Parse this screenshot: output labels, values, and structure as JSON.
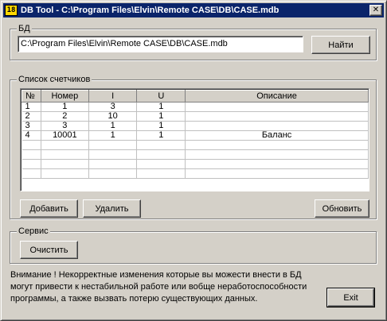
{
  "window": {
    "title": "DB Tool - C:\\Program Files\\Elvin\\Remote CASE\\DB\\CASE.mdb",
    "icon_glyph": "18",
    "close_glyph": "✕"
  },
  "db_group": {
    "label": "БД",
    "path_value": "C:\\Program Files\\Elvin\\Remote CASE\\DB\\CASE.mdb",
    "find_button": "Найти"
  },
  "counters_group": {
    "label": "Список счетчиков",
    "columns": [
      "№",
      "Номер",
      "I",
      "U",
      "Описание"
    ],
    "rows": [
      {
        "n": "1",
        "number": "1",
        "i": "3",
        "u": "1",
        "desc": ""
      },
      {
        "n": "2",
        "number": "2",
        "i": "10",
        "u": "1",
        "desc": ""
      },
      {
        "n": "3",
        "number": "3",
        "i": "1",
        "u": "1",
        "desc": ""
      },
      {
        "n": "4",
        "number": "10001",
        "i": "1",
        "u": "1",
        "desc": "Баланс"
      }
    ],
    "add_button": "Добавить",
    "delete_button": "Удалить",
    "refresh_button": "Обновить"
  },
  "service_group": {
    "label": "Сервис",
    "clear_button": "Очистить"
  },
  "warning_text": "Внимание ! Некорректные изменения которые вы можести внести в БД могут привести к нестабильной работе или вобще неработоспособности программы, а также вызвать потерю существующих данных.",
  "exit_button": "Exit"
}
